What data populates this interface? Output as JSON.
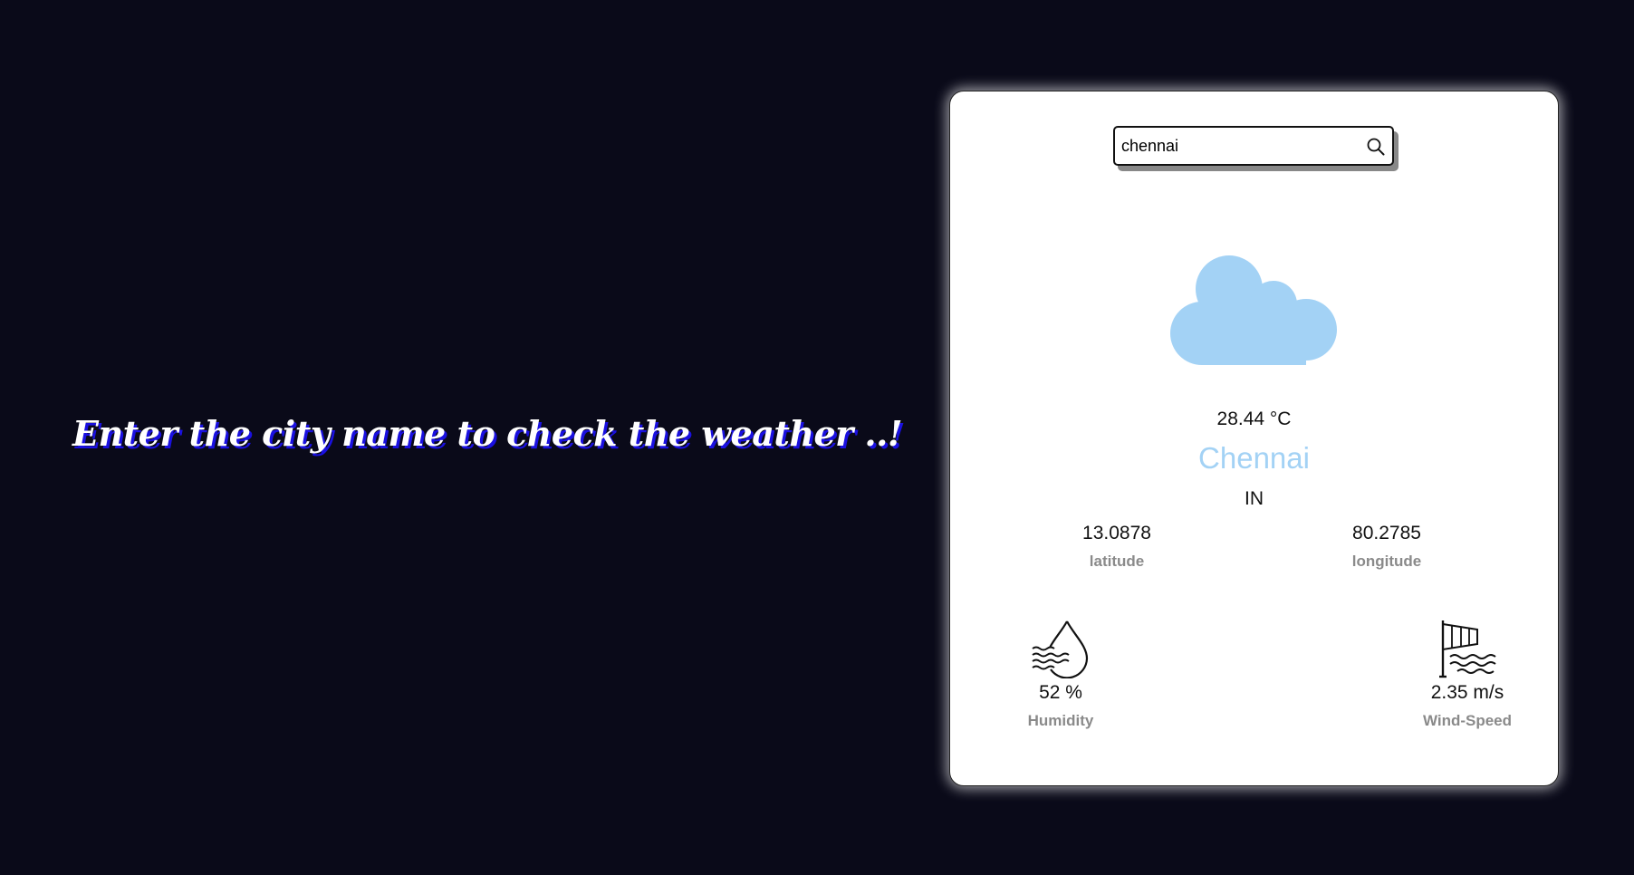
{
  "headline": "Enter the city name to check the weather ..!",
  "search": {
    "value": "chennai",
    "icon": "search-icon"
  },
  "weather": {
    "condition_icon": "cloud-icon",
    "temperature": "28.44 °C",
    "city": "Chennai",
    "country": "IN",
    "latitude": {
      "value": "13.0878",
      "label": "latitude"
    },
    "longitude": {
      "value": "80.2785",
      "label": "longitude"
    },
    "humidity": {
      "icon": "humidity-drop-icon",
      "value": "52 %",
      "label": "Humidity"
    },
    "wind": {
      "icon": "windsock-icon",
      "value": "2.35 m/s",
      "label": "Wind-Speed"
    }
  },
  "colors": {
    "page_background": "#0a0a19",
    "headline_shadow": "#1a10e0",
    "cloud": "#a3d2f5",
    "city": "#a3d2f5",
    "label": "#8a8a8a"
  }
}
